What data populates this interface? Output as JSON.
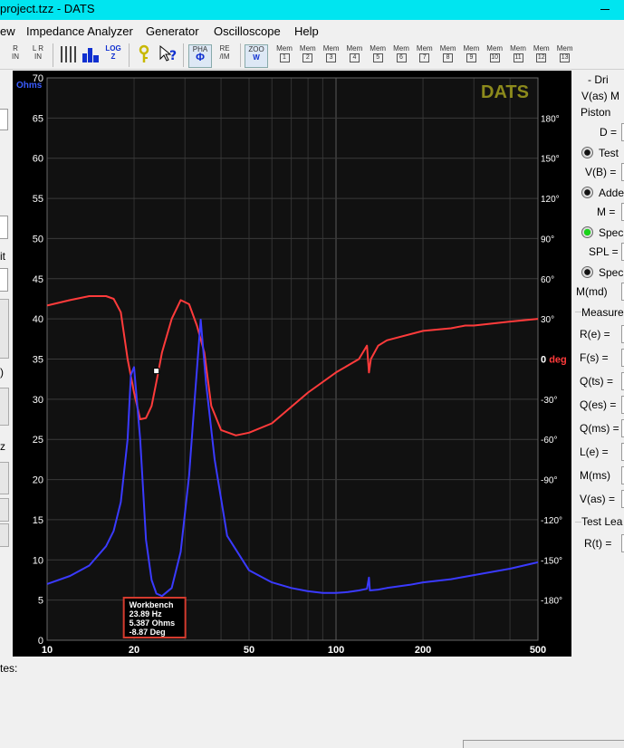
{
  "window": {
    "title": "project.tzz - DATS"
  },
  "menu": [
    "ew",
    "Impedance Analyzer",
    "Generator",
    "Oscilloscope",
    "Help"
  ],
  "toolbar": {
    "buttons": [
      {
        "l1": "R",
        "l2": "IN"
      },
      {
        "l1": "L R",
        "l2": "IN"
      },
      {
        "l1": "LOG",
        "l2": "Z"
      },
      {
        "l1": "PHA",
        "l2": ""
      },
      {
        "l1": "RE",
        "l2": "/IM"
      },
      {
        "l1": "ZOO",
        "l2": "W"
      }
    ],
    "mem_label": "Mem",
    "mem_slots": [
      "1",
      "2",
      "3",
      "4",
      "5",
      "6",
      "7",
      "8",
      "9",
      "10",
      "11",
      "12",
      "13"
    ]
  },
  "left_panel": {
    "labels": [
      "it",
      ")",
      "z"
    ]
  },
  "right_panel": {
    "header": "- Dri",
    "vas_label": "V(as) M",
    "piston": "Piston",
    "d_label": "D =",
    "radio_test": "Test",
    "vb_label": "V(B) =",
    "radio_added": "Adde",
    "m_label": "M =",
    "radio_spec1": "Spec",
    "spl_label": "SPL =",
    "radio_spec2": "Spec",
    "mmd_label": "M(md)",
    "measured_header": "Measure",
    "params": [
      "R(e) =",
      "F(s) =",
      "Q(ts) =",
      "Q(es) =",
      "Q(ms) =",
      "L(e) =",
      "M(ms)",
      "V(as) ="
    ],
    "test_lead_header": "Test Lea",
    "rt_label": "R(t) ="
  },
  "bottom": {
    "notes_label": "tes:"
  },
  "chart_data": {
    "type": "line",
    "brand": "DATS",
    "x_scale": "log",
    "xlim": [
      10,
      500
    ],
    "x_ticks": [
      10,
      20,
      50,
      100,
      200,
      500
    ],
    "x_tick_labels": [
      "10",
      "20",
      "50",
      "100",
      "200",
      "500"
    ],
    "ylim": [
      0,
      70
    ],
    "y_ticks": [
      0,
      5,
      10,
      15,
      20,
      25,
      30,
      35,
      40,
      45,
      50,
      55,
      60,
      65,
      70
    ],
    "y_unit_label": "Ohms",
    "y2lim": [
      -210,
      210
    ],
    "y2_ticks": [
      180,
      150,
      120,
      90,
      60,
      30,
      0,
      -30,
      -60,
      -90,
      -120,
      -150,
      -180
    ],
    "y2_tick_labels": [
      "180°",
      "150°",
      "120°",
      "90°",
      "60°",
      "30°",
      "0 deg",
      "-30°",
      "-60°",
      "-90°",
      "-120°",
      "-150°",
      "-180°"
    ],
    "colors": {
      "impedance": "#3a3aff",
      "phase": "#ff3b3b",
      "brand": "#8c8a1c",
      "cursor_box": "#d43b2e"
    },
    "series": [
      {
        "name": "Ohms",
        "x": [
          10,
          12,
          14,
          16,
          17,
          18,
          19,
          19.5,
          20,
          21,
          22,
          23,
          23.89,
          25,
          27,
          29,
          31,
          32.5,
          34,
          35.5,
          38,
          42,
          50,
          60,
          70,
          80,
          90,
          100,
          110,
          120,
          128,
          130,
          131,
          140,
          150,
          180,
          200,
          250,
          300,
          400,
          500
        ],
        "y": [
          7,
          8,
          9.3,
          11.7,
          13.6,
          17.2,
          25,
          33,
          34,
          25,
          12.5,
          7.5,
          5.8,
          5.5,
          6.5,
          11,
          20.5,
          30.5,
          39.9,
          32,
          22.5,
          13,
          8.7,
          7.2,
          6.5,
          6.1,
          5.9,
          5.9,
          6,
          6.2,
          6.4,
          7.8,
          6.2,
          6.3,
          6.5,
          6.9,
          7.2,
          7.6,
          8.1,
          8.9,
          9.7
        ]
      },
      {
        "name": "Phase (deg)",
        "x": [
          10,
          12,
          14,
          16,
          17,
          18,
          19,
          20,
          21,
          22,
          23,
          24,
          25,
          27,
          29,
          31,
          33,
          35,
          37,
          40,
          45,
          50,
          60,
          80,
          100,
          120,
          128,
          130,
          132,
          140,
          150,
          200,
          250,
          280,
          300,
          400,
          500
        ],
        "y": [
          40,
          44,
          47,
          47,
          45,
          35,
          0,
          -25,
          -45,
          -44,
          -35,
          -15,
          5,
          30,
          44,
          41,
          25,
          5,
          -35,
          -53,
          -57,
          -55,
          -48,
          -25,
          -10,
          0,
          10,
          -10,
          0,
          10,
          14,
          21,
          23,
          25,
          25,
          28,
          30
        ]
      }
    ],
    "cursor": {
      "title": "Workbench",
      "freq": "23.89 Hz",
      "ohms": "5.387 Ohms",
      "deg": "-8.87 Deg",
      "x": 23.89,
      "y2": -8.87
    }
  }
}
